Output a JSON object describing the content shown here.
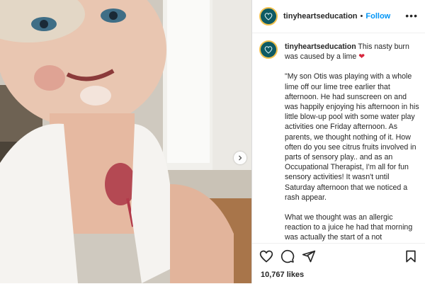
{
  "post": {
    "username": "tinyheartseducation",
    "follow_label": "Follow",
    "separator": "•",
    "more_label": "•••",
    "likes": "10,767 likes"
  },
  "caption": {
    "username": "tinyheartseducation",
    "headline": " This nasty burn was caused by a lime ",
    "headline_emoji": "❤",
    "paragraph1": "\"My son Otis was playing with a whole lime off our lime tree earlier that afternoon. He had sunscreen on and was happily enjoying his afternoon in his little blow-up pool with some water play activities one Friday afternoon. As parents, we thought nothing of it. How often do you see citrus fruits involved in parts of sensory play.. and as an Occupational Therapist, I'm all for fun sensory activities! It wasn't until Saturday afternoon that we noticed a rash appear.",
    "paragraph2": "What we thought was an allergic reaction to a juice he had that morning was actually the start of a not"
  },
  "colors": {
    "follow": "#0095f6",
    "avatar_bg": "#0e5a63",
    "avatar_ring": "#f2c14e",
    "text": "#262626"
  },
  "icons": [
    "heart-icon",
    "comment-icon",
    "share-icon",
    "bookmark-icon",
    "more-icon",
    "chevron-right-icon"
  ]
}
